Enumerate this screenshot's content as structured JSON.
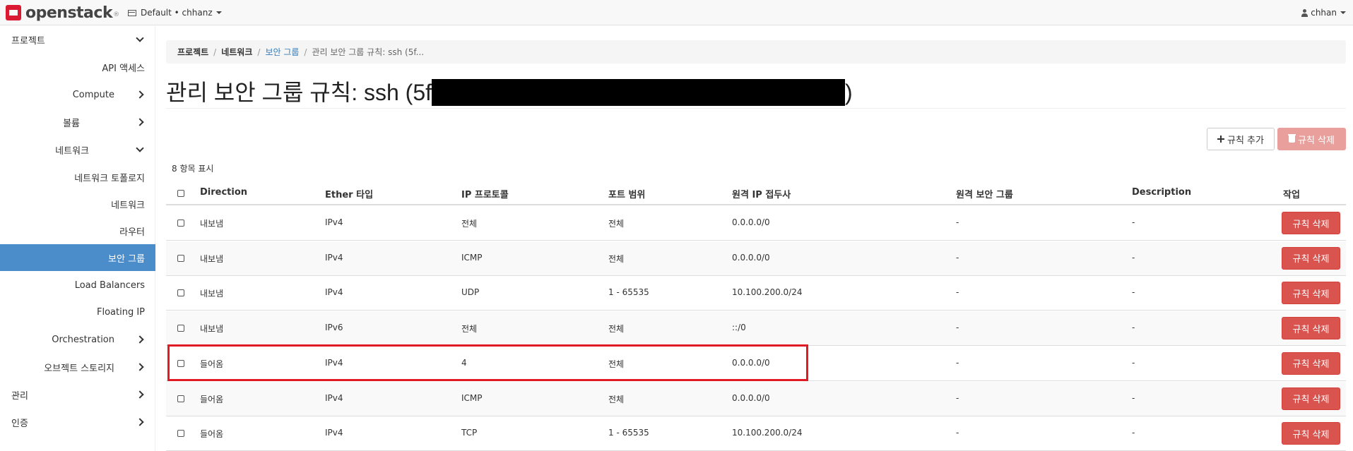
{
  "topbar": {
    "brand": "openstack",
    "brand_tm": "®",
    "project": "Default • chhanz",
    "user": "chhan"
  },
  "sidebar": {
    "items": [
      {
        "label": "프로젝트",
        "chevron": "down"
      },
      {
        "label": "API 액세스"
      },
      {
        "label": "Compute",
        "chevron": "right"
      },
      {
        "label": "볼륨",
        "chevron": "right"
      },
      {
        "label": "네트워크",
        "chevron": "down"
      },
      {
        "label": "네트워크 토폴로지"
      },
      {
        "label": "네트워크"
      },
      {
        "label": "라우터"
      },
      {
        "label": "보안 그룹",
        "active": true
      },
      {
        "label": "Load Balancers"
      },
      {
        "label": "Floating IP"
      },
      {
        "label": "Orchestration",
        "chevron": "right"
      },
      {
        "label": "오브젝트 스토리지",
        "chevron": "right"
      },
      {
        "label": "관리",
        "chevron": "right"
      },
      {
        "label": "인증",
        "chevron": "right"
      }
    ]
  },
  "breadcrumb": {
    "items": [
      "프로젝트",
      "네트워크",
      "보안 그룹",
      "관리 보안 그룹 규칙: ssh (5f..."
    ]
  },
  "page": {
    "title_prefix": "관리 보안 그룹 규칙: ssh (5f",
    "title_suffix": ")"
  },
  "actions": {
    "add_rule": "규칙 추가",
    "delete_rules": "규칙 삭제"
  },
  "table": {
    "count_text": "8 항목 표시",
    "headers": [
      "Direction",
      "Ether 타입",
      "IP 프로토콜",
      "포트 범위",
      "원격 IP 접두사",
      "원격 보안 그룹",
      "Description",
      "작업"
    ],
    "rows": [
      {
        "direction": "내보냄",
        "ether": "IPv4",
        "protocol": "전체",
        "port": "전체",
        "prefix": "0.0.0.0/0",
        "group": "-",
        "desc": "-",
        "action": "규칙 삭제"
      },
      {
        "direction": "내보냄",
        "ether": "IPv4",
        "protocol": "ICMP",
        "port": "전체",
        "prefix": "0.0.0.0/0",
        "group": "-",
        "desc": "-",
        "action": "규칙 삭제"
      },
      {
        "direction": "내보냄",
        "ether": "IPv4",
        "protocol": "UDP",
        "port": "1 - 65535",
        "prefix": "10.100.200.0/24",
        "group": "-",
        "desc": "-",
        "action": "규칙 삭제"
      },
      {
        "direction": "내보냄",
        "ether": "IPv6",
        "protocol": "전체",
        "port": "전체",
        "prefix": "::/0",
        "group": "-",
        "desc": "-",
        "action": "규칙 삭제"
      },
      {
        "direction": "들어옴",
        "ether": "IPv4",
        "protocol": "4",
        "port": "전체",
        "prefix": "0.0.0.0/0",
        "group": "-",
        "desc": "-",
        "action": "규칙 삭제"
      },
      {
        "direction": "들어옴",
        "ether": "IPv4",
        "protocol": "ICMP",
        "port": "전체",
        "prefix": "0.0.0.0/0",
        "group": "-",
        "desc": "-",
        "action": "규칙 삭제"
      },
      {
        "direction": "들어옴",
        "ether": "IPv4",
        "protocol": "TCP",
        "port": "1 - 65535",
        "prefix": "10.100.200.0/24",
        "group": "-",
        "desc": "-",
        "action": "규칙 삭제"
      }
    ]
  },
  "colors": {
    "active_nav": "#4b8ccb",
    "danger": "#d9534f",
    "danger_disabled": "#e9a09c",
    "highlight": "#e01b24",
    "link": "#337ab7"
  }
}
